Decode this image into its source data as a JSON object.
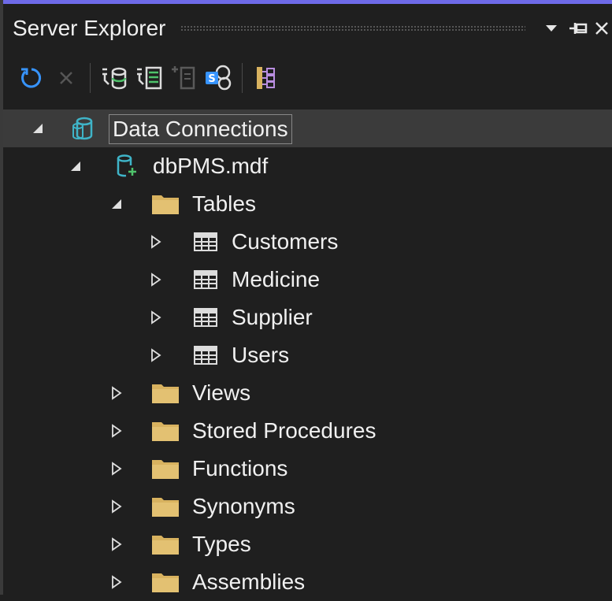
{
  "window": {
    "title": "Server Explorer",
    "controls": [
      "dropdown-icon",
      "pin-icon",
      "close-icon"
    ]
  },
  "toolbar": {
    "tools": [
      {
        "name": "refresh-icon",
        "enabled": true
      },
      {
        "name": "stop-icon",
        "enabled": false
      },
      {
        "name": "connect-to-database-icon",
        "enabled": true
      },
      {
        "name": "connect-to-server-icon",
        "enabled": true
      },
      {
        "name": "add-data-source-icon",
        "enabled": false
      },
      {
        "name": "connect-to-sharepoint-icon",
        "enabled": true
      },
      {
        "name": "show-hierarchy-icon",
        "enabled": true
      }
    ]
  },
  "tree": {
    "items": [
      {
        "label": "Data Connections",
        "level": 0,
        "expanded": true,
        "icon": "data-connections-icon",
        "selected": true
      },
      {
        "label": "dbPMS.mdf",
        "level": 1,
        "expanded": true,
        "icon": "database-file-icon"
      },
      {
        "label": "Tables",
        "level": 2,
        "expanded": true,
        "icon": "folder-icon"
      },
      {
        "label": "Customers",
        "level": 3,
        "expanded": false,
        "icon": "table-icon"
      },
      {
        "label": "Medicine",
        "level": 3,
        "expanded": false,
        "icon": "table-icon"
      },
      {
        "label": "Supplier",
        "level": 3,
        "expanded": false,
        "icon": "table-icon"
      },
      {
        "label": "Users",
        "level": 3,
        "expanded": false,
        "icon": "table-icon"
      },
      {
        "label": "Views",
        "level": 2,
        "expanded": false,
        "icon": "folder-icon"
      },
      {
        "label": "Stored Procedures",
        "level": 2,
        "expanded": false,
        "icon": "folder-icon"
      },
      {
        "label": "Functions",
        "level": 2,
        "expanded": false,
        "icon": "folder-icon"
      },
      {
        "label": "Synonyms",
        "level": 2,
        "expanded": false,
        "icon": "folder-icon"
      },
      {
        "label": "Types",
        "level": 2,
        "expanded": false,
        "icon": "folder-icon"
      },
      {
        "label": "Assemblies",
        "level": 2,
        "expanded": false,
        "icon": "folder-icon"
      }
    ]
  },
  "colors": {
    "background": "#1f1f1f",
    "accent": "#6e6ae8",
    "selection": "#3b3b3b",
    "folder": "#d8b25f",
    "refresh": "#3794ff"
  }
}
